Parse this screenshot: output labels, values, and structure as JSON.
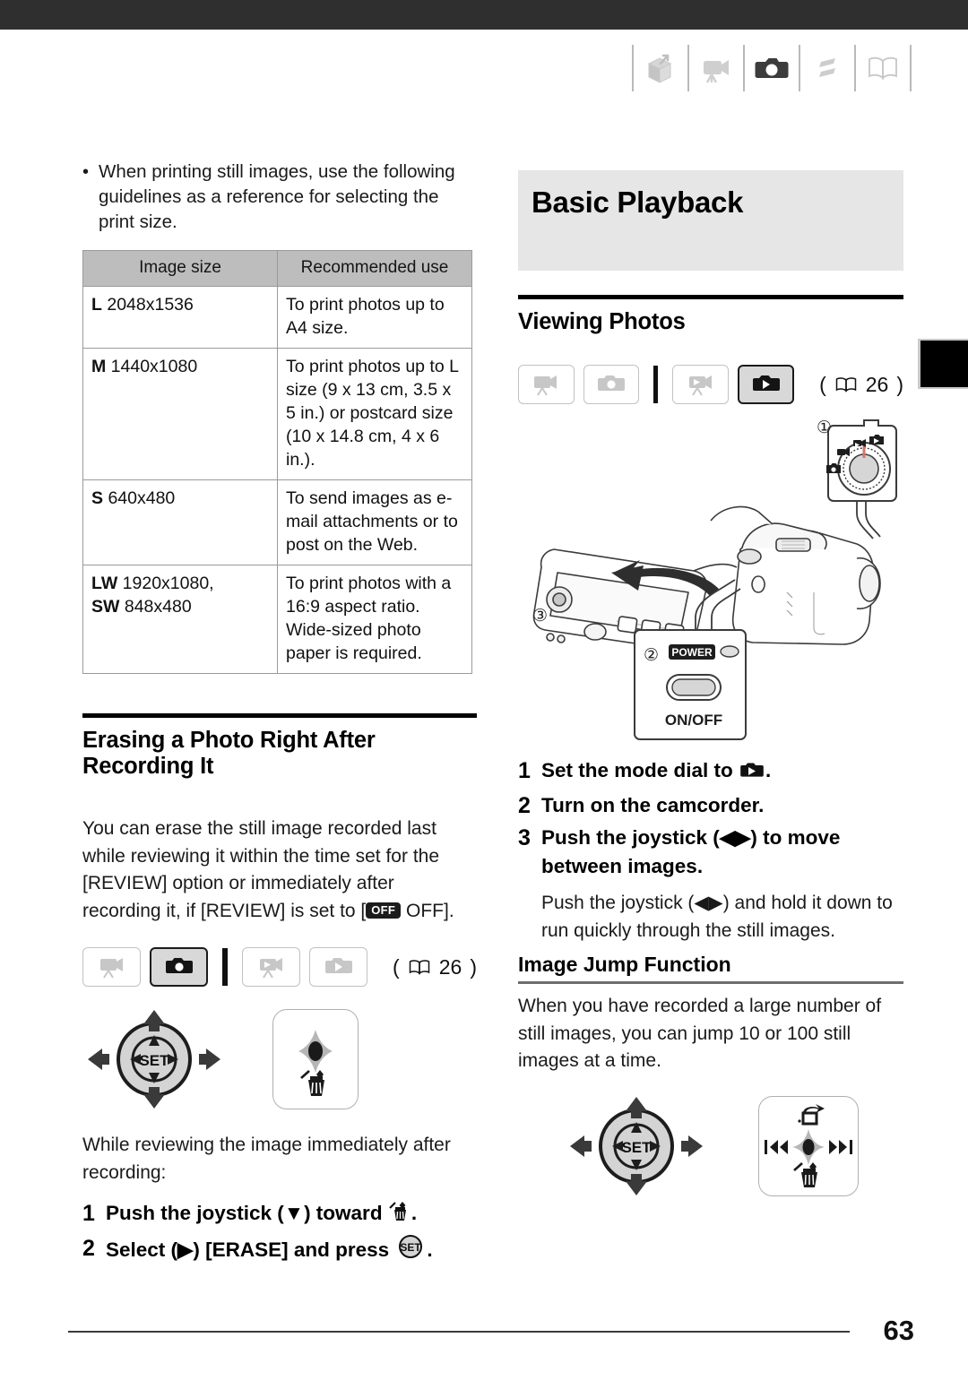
{
  "page": {
    "number": "63",
    "edge_tab_color": "#000000"
  },
  "header": {
    "icons": [
      {
        "name": "unpacking-box-icon",
        "label": "Introduction / Preparations"
      },
      {
        "name": "video-camera-icon",
        "label": "Video Recording"
      },
      {
        "name": "photo-camera-icon",
        "label": "Photos",
        "active": true
      },
      {
        "name": "transfer-arrows-icon",
        "label": "External Connections"
      },
      {
        "name": "open-book-icon",
        "label": "Additional Information"
      }
    ]
  },
  "left_column": {
    "bullet": "When printing still images, use the following guidelines as a reference for selecting the print size.",
    "table": {
      "headers": [
        "Image size",
        "Recommended use"
      ],
      "rows": [
        {
          "size_tag": "L",
          "size_value": "2048x1536",
          "use": "To print photos up to A4 size."
        },
        {
          "size_tag": "M",
          "size_value": "1440x1080",
          "use": "To print photos up to L size (9 x 13 cm, 3.5 x 5 in.) or postcard size (10 x 14.8 cm, 4 x 6 in.)."
        },
        {
          "size_tag": "S",
          "size_value": "640x480",
          "use": "To send images as e-mail attachments or to post on the Web."
        },
        {
          "size_tag": "LW",
          "size_value": "1920x1080,",
          "size_tag2": "SW",
          "size_value2": "848x480",
          "use": "To print photos with a 16:9 aspect ratio. Wide-sized photo paper is required."
        }
      ]
    },
    "section_heading": "Erasing a Photo Right After Recording It",
    "paragraph_part1": "You can erase the still image recorded last while reviewing it within the time set for the [REVIEW] option or immediately after recording it, if [REVIEW] is set to [",
    "off_badge": "OFF",
    "paragraph_part2": " OFF].",
    "mode_row": {
      "buttons": [
        {
          "name": "mode-video-record-icon",
          "active": false
        },
        {
          "name": "mode-photo-record-icon",
          "active": true
        },
        {
          "name": "mode-video-playback-icon",
          "active": false
        },
        {
          "name": "mode-photo-playback-icon",
          "active": false
        }
      ],
      "page_ref": "26"
    },
    "review_intro": "While reviewing the image immediately after recording:",
    "steps": [
      {
        "num": "1",
        "text_before": "Push the joystick (▼) toward",
        "icon": "erase-trash-icon",
        "text_after": "."
      },
      {
        "num": "2",
        "text_before": "Select (▶) [ERASE] and press",
        "icon": "set-button-icon",
        "text_after": "."
      }
    ]
  },
  "right_column": {
    "chapter_title": "Basic Playback",
    "section_heading": "Viewing Photos",
    "mode_row": {
      "buttons": [
        {
          "name": "mode-video-record-icon",
          "active": false
        },
        {
          "name": "mode-photo-record-icon",
          "active": false
        },
        {
          "name": "mode-video-playback-icon",
          "active": false
        },
        {
          "name": "mode-photo-playback-icon",
          "active": true
        }
      ],
      "page_ref": "26"
    },
    "illustration": {
      "callouts": [
        "1",
        "2",
        "3"
      ],
      "power_label": "POWER",
      "onoff_label": "ON/OFF"
    },
    "steps": [
      {
        "num": "1",
        "text_before": "Set the mode dial to",
        "icon": "photo-playback-icon",
        "text_after": "."
      },
      {
        "num": "2",
        "text_before": "Turn on the camcorder.",
        "icon": "",
        "text_after": ""
      },
      {
        "num": "3",
        "text_before": "Push the joystick (◀▶) to move between images.",
        "icon": "",
        "text_after": ""
      }
    ],
    "note_paragraph": "Push the joystick (◀▶) and hold it down to run quickly through the still images.",
    "subsection_heading": "Image Jump Function",
    "subsection_paragraph": "When you have recorded a large number of still images, you can jump 10 or 100 still images at a time.",
    "jump_guide": {
      "top_icon": "image-jump-icon",
      "left_icon": "skip-back-icon",
      "right_icon": "skip-forward-icon",
      "bottom_icon": "erase-trash-icon"
    }
  }
}
